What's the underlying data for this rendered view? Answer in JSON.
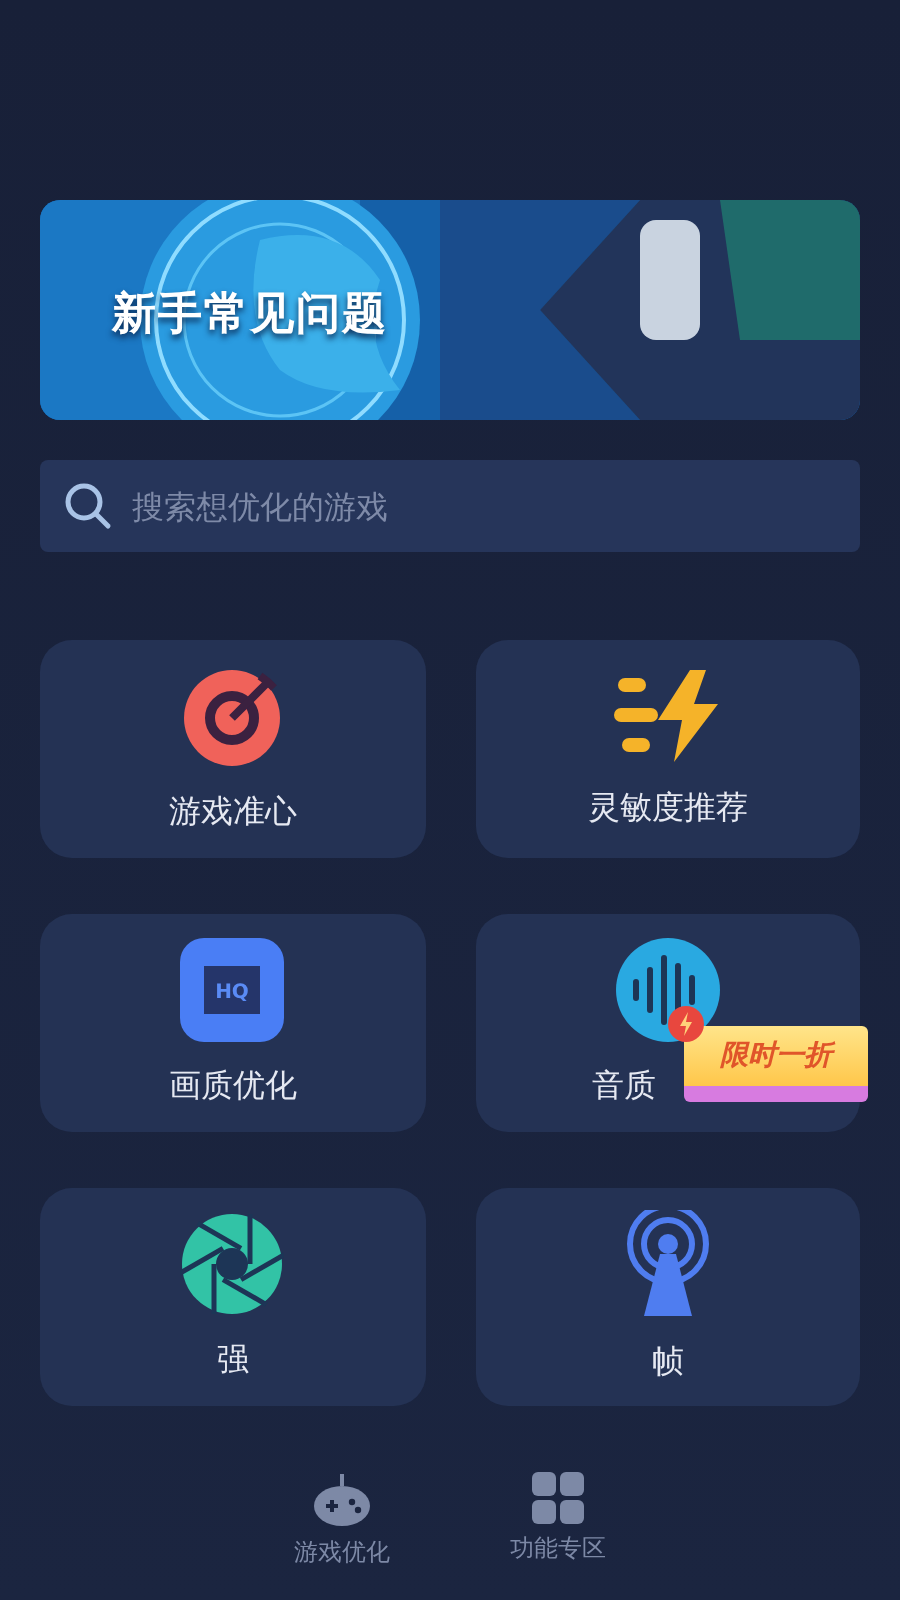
{
  "banner": {
    "title": "新手常见问题"
  },
  "search": {
    "placeholder": "搜索想优化的游戏"
  },
  "features": [
    {
      "kind": "target",
      "label": "游戏准心"
    },
    {
      "kind": "bolt",
      "label": "灵敏度推荐"
    },
    {
      "kind": "hq",
      "label": "画质优化",
      "icon_text": "HQ"
    },
    {
      "kind": "wave",
      "label": "音质",
      "badge": "限时一折"
    },
    {
      "kind": "aperture",
      "label": "强"
    },
    {
      "kind": "tower",
      "label": "帧"
    }
  ],
  "nav": [
    {
      "kind": "gamepad",
      "label": "游戏优化"
    },
    {
      "kind": "grid",
      "label": "功能专区"
    }
  ]
}
